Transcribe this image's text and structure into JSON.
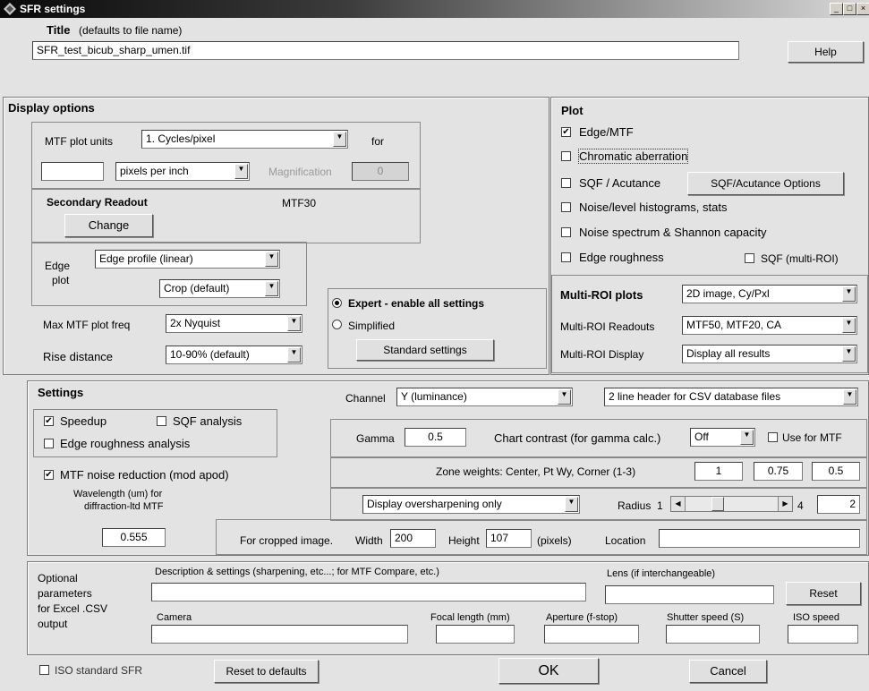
{
  "window": {
    "title": "SFR settings",
    "min": "_",
    "max": "□",
    "close": "×"
  },
  "title_section": {
    "label": "Title",
    "hint": "(defaults to file name)",
    "value": "SFR_test_bicub_sharp_umen.tif",
    "help_label": "Help"
  },
  "display": {
    "heading": "Display options",
    "mtf_units_label": "MTF plot units",
    "mtf_units_value": "1. Cycles/pixel",
    "for_label": "for",
    "ppi_input": "",
    "ppi_select": "pixels per inch",
    "magnification_label": "Magnification",
    "magnification_value": "0",
    "secondary_heading": "Secondary Readout",
    "secondary_value": "MTF30",
    "change_label": "Change",
    "edge_label_1": "Edge",
    "edge_label_2": "plot",
    "edge_profile": "Edge profile (linear)",
    "crop": "Crop (default)",
    "max_freq_label": "Max MTF plot freq",
    "max_freq_value": "2x Nyquist",
    "rise_label": "Rise distance",
    "rise_value": "10-90% (default)",
    "expert_label": "Expert - enable all settings",
    "simplified_label": "Simplified",
    "standard_label": "Standard settings"
  },
  "plot": {
    "heading": "Plot",
    "edge_mtf": "Edge/MTF",
    "chromatic": "Chromatic aberration",
    "sqf": "SQF / Acutance",
    "sqf_options": "SQF/Acutance Options",
    "noise_level": "Noise/level histograms, stats",
    "noise_spectrum": "Noise spectrum & Shannon capacity",
    "edge_roughness": "Edge roughness",
    "sqf_multi": "SQF (multi-ROI)",
    "multi_heading": "Multi-ROI plots",
    "multi_plots_value": "2D image, Cy/Pxl",
    "multi_readouts_label": "Multi-ROI Readouts",
    "multi_readouts_value": "MTF50, MTF20, CA",
    "multi_display_label": "Multi-ROI Display",
    "multi_display_value": "Display all results"
  },
  "settings": {
    "heading": "Settings",
    "channel_label": "Channel",
    "channel_value": "Y (luminance)",
    "header_value": "2 line header for CSV database files",
    "speedup": "Speedup",
    "sqf_analysis": "SQF analysis",
    "edge_roughness_analysis": "Edge roughness analysis",
    "mtf_noise": "MTF noise reduction (mod apod)",
    "wavelength_1": "Wavelength (um) for",
    "wavelength_2": "diffraction-ltd MTF",
    "wavelength_value": "0.555",
    "gamma_label": "Gamma",
    "gamma_value": "0.5",
    "chart_contrast_label": "Chart contrast (for gamma calc.)",
    "chart_contrast_value": "Off",
    "use_for_mtf": "Use for MTF",
    "zone_label": "Zone weights:  Center, Pt Wy, Corner (1-3)",
    "zone_1": "1",
    "zone_2": "0.75",
    "zone_3": "0.5",
    "oversharp_value": "Display oversharpening only",
    "radius_label": "Radius",
    "radius_min": "1",
    "radius_max": "4",
    "radius_value": "2",
    "radius_fraction": 0.33,
    "cropped_label": "For cropped image.",
    "width_label": "Width",
    "width_value": "200",
    "height_label": "Height",
    "height_value": "107",
    "pixels_label": "(pixels)",
    "location_label": "Location",
    "location_value": ""
  },
  "optional": {
    "label_1": "Optional",
    "label_2": "parameters",
    "label_3": "for Excel .CSV",
    "label_4": "output",
    "description_label": "Description & settings  (sharpening, etc...;  for MTF Compare, etc.)",
    "lens_label": "Lens (if interchangeable)",
    "reset_label": "Reset",
    "camera_label": "Camera",
    "focal_label": "Focal length (mm)",
    "aperture_label": "Aperture (f-stop)",
    "shutter_label": "Shutter speed (S)",
    "iso_label": "ISO speed"
  },
  "bottom": {
    "iso_standard": "ISO standard SFR",
    "reset_defaults": "Reset to defaults",
    "ok": "OK",
    "cancel": "Cancel"
  }
}
